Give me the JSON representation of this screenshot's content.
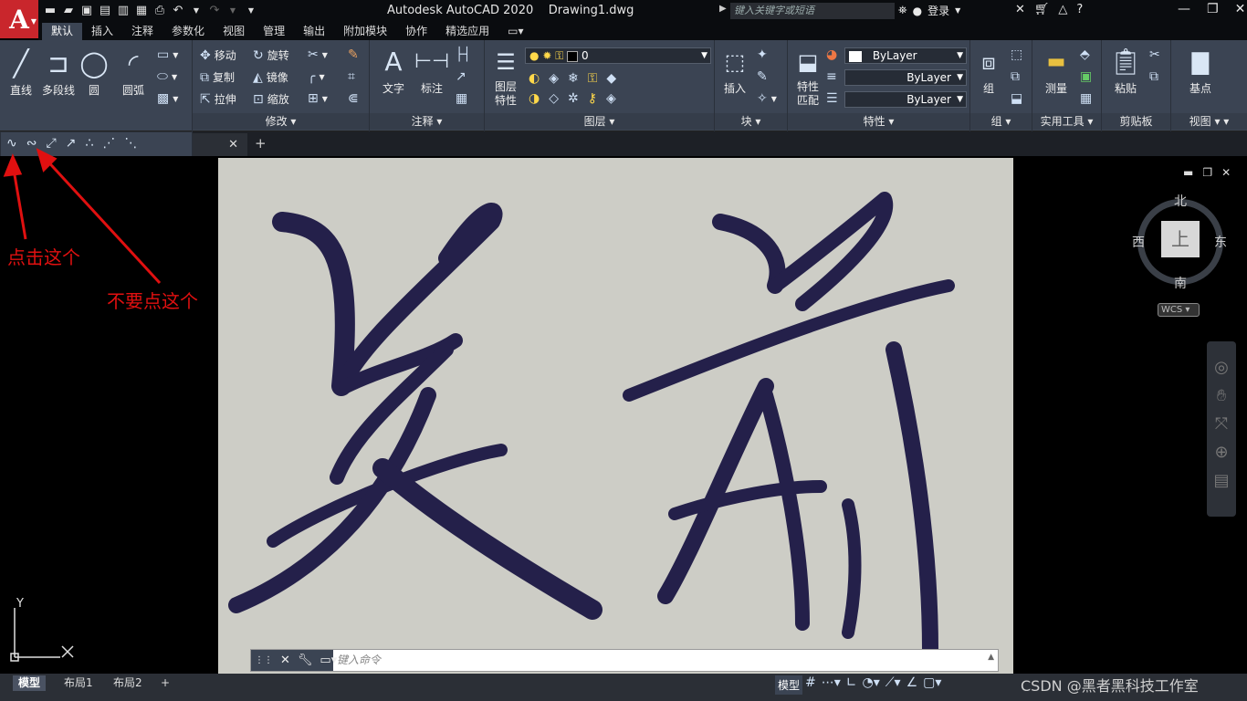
{
  "app": {
    "logo_letter": "A",
    "title": "Autodesk AutoCAD 2020",
    "drawing": "Drawing1.dwg",
    "search_placeholder": "键入关键字或短语",
    "login": "登录"
  },
  "tabs": [
    "默认",
    "插入",
    "注释",
    "参数化",
    "视图",
    "管理",
    "输出",
    "附加模块",
    "协作",
    "精选应用"
  ],
  "ribbon": {
    "draw": {
      "line": "直线",
      "polyline": "多段线",
      "circle": "圆",
      "arc": "圆弧",
      "label": "绘图"
    },
    "modify": {
      "move": "移动",
      "rotate": "旋转",
      "copy": "复制",
      "mirror": "镜像",
      "stretch": "拉伸",
      "scale": "缩放",
      "label": "修改"
    },
    "annotation": {
      "text": "文字",
      "dimension": "标注",
      "label": "注释"
    },
    "layers": {
      "props_line1": "图层",
      "props_line2": "特性",
      "current": "0",
      "label": "图层"
    },
    "block": {
      "insert": "插入",
      "label": "块"
    },
    "properties": {
      "match_line1": "特性",
      "match_line2": "匹配",
      "color": "ByLayer",
      "linetype": "ByLayer",
      "lineweight": "ByLayer",
      "label": "特性"
    },
    "groups": {
      "group": "组",
      "label": "组"
    },
    "utilities": {
      "measure": "测量",
      "label": "实用工具"
    },
    "clipboard": {
      "paste": "粘贴",
      "label": "剪贴板"
    },
    "view": {
      "base": "基点",
      "label": "视图"
    }
  },
  "annotations": {
    "click_this": "点击这个",
    "dont_click": "不要点这个"
  },
  "viewcube": {
    "north": "北",
    "south": "南",
    "east": "东",
    "west": "西",
    "top": "上",
    "wcs": "WCS"
  },
  "ucs": {
    "y": "Y"
  },
  "command": {
    "placeholder": "键入命令"
  },
  "status": {
    "model_tab": "模型",
    "layout1": "布局1",
    "layout2": "布局2",
    "model_btn": "模型",
    "watermark": "CSDN @黑者黑科技工作室"
  },
  "icons": [
    "search-icon",
    "login-icon",
    "cart-icon",
    "help-icon",
    "minimize-icon",
    "restore-icon",
    "close-icon",
    "gear-icon",
    "pan-icon",
    "orbit-icon"
  ]
}
